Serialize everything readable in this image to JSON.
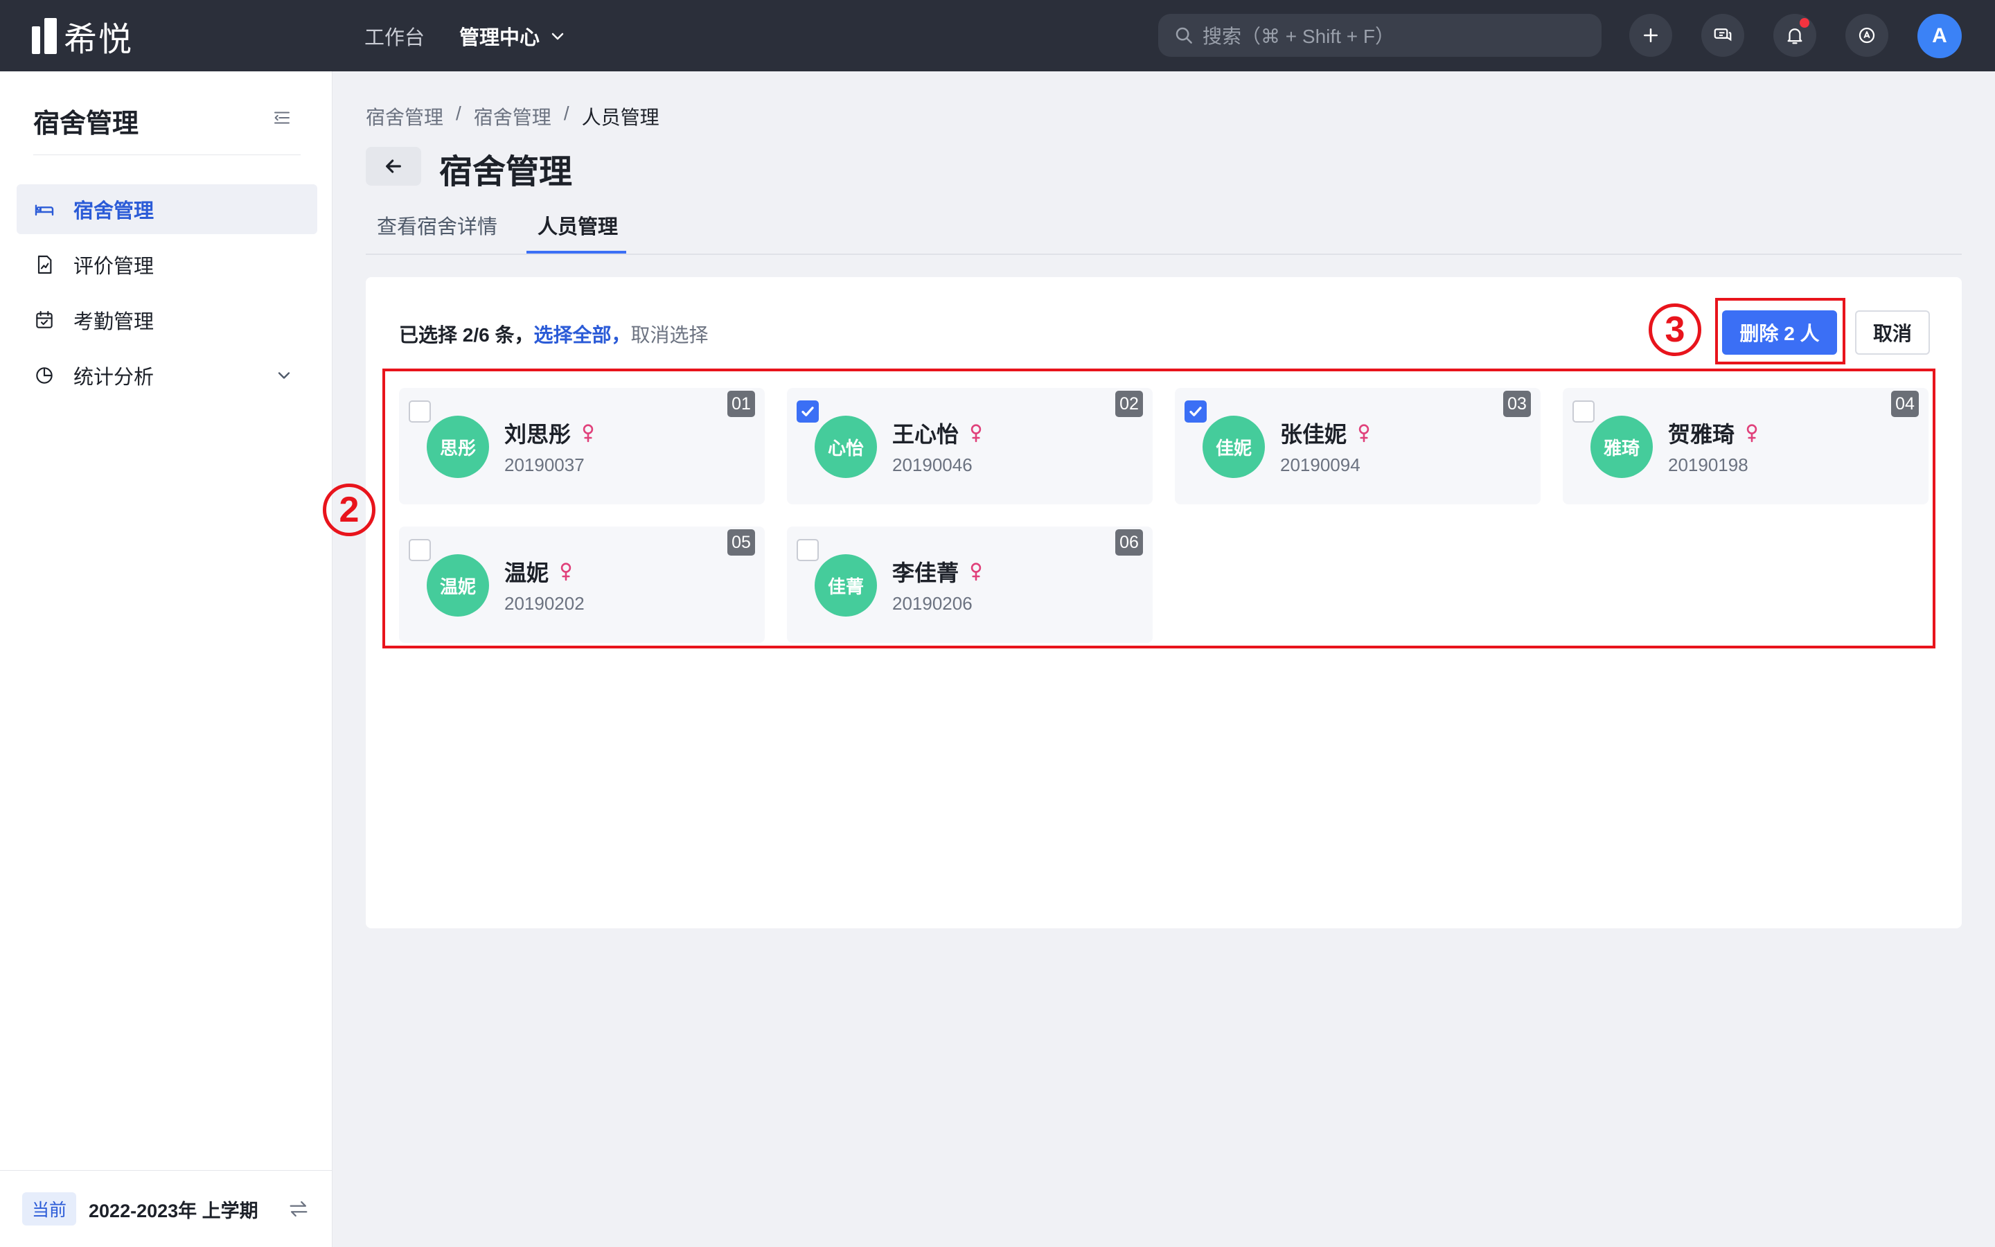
{
  "app": {
    "logo_text": "希悦"
  },
  "topnav": {
    "workbench": "工作台",
    "admin_center": "管理中心"
  },
  "search": {
    "placeholder": "搜索（⌘ + Shift + F）"
  },
  "user": {
    "avatar_letter": "A"
  },
  "sidebar": {
    "title": "宿舍管理",
    "items": [
      {
        "label": "宿舍管理",
        "icon": "bed-icon",
        "active": true
      },
      {
        "label": "评价管理",
        "icon": "evaluation-doc-icon"
      },
      {
        "label": "考勤管理",
        "icon": "calendar-check-icon"
      },
      {
        "label": "统计分析",
        "icon": "pie-chart-icon",
        "expandable": true
      }
    ],
    "term_badge": "当前",
    "term_text": "2022-2023年 上学期"
  },
  "breadcrumb": [
    "宿舍管理",
    "宿舍管理",
    "人员管理"
  ],
  "page": {
    "title": "宿舍管理"
  },
  "tabs": [
    {
      "label": "查看宿舍详情"
    },
    {
      "label": "人员管理",
      "active": true
    }
  ],
  "selection": {
    "summary": "已选择 2/6 条，",
    "select_all": "选择全部，",
    "clear": "取消选择"
  },
  "actions": {
    "delete_label": "删除 2 人",
    "cancel_label": "取消"
  },
  "annotations": {
    "a2": "2",
    "a3": "3"
  },
  "colors": {
    "accent": "#3b6ff5",
    "avatar": "#45cc9b",
    "female": "#e0407a",
    "annotation": "#e8141c"
  },
  "members": [
    {
      "index": "01",
      "avatar_text": "思彤",
      "name": "刘思彤",
      "student_id": "20190037",
      "checked": false
    },
    {
      "index": "02",
      "avatar_text": "心怡",
      "name": "王心怡",
      "student_id": "20190046",
      "checked": true
    },
    {
      "index": "03",
      "avatar_text": "佳妮",
      "name": "张佳妮",
      "student_id": "20190094",
      "checked": true
    },
    {
      "index": "04",
      "avatar_text": "雅琦",
      "name": "贺雅琦",
      "student_id": "20190198",
      "checked": false
    },
    {
      "index": "05",
      "avatar_text": "温妮",
      "name": "温妮",
      "student_id": "20190202",
      "checked": false
    },
    {
      "index": "06",
      "avatar_text": "佳菁",
      "name": "李佳菁",
      "student_id": "20190206",
      "checked": false
    }
  ]
}
